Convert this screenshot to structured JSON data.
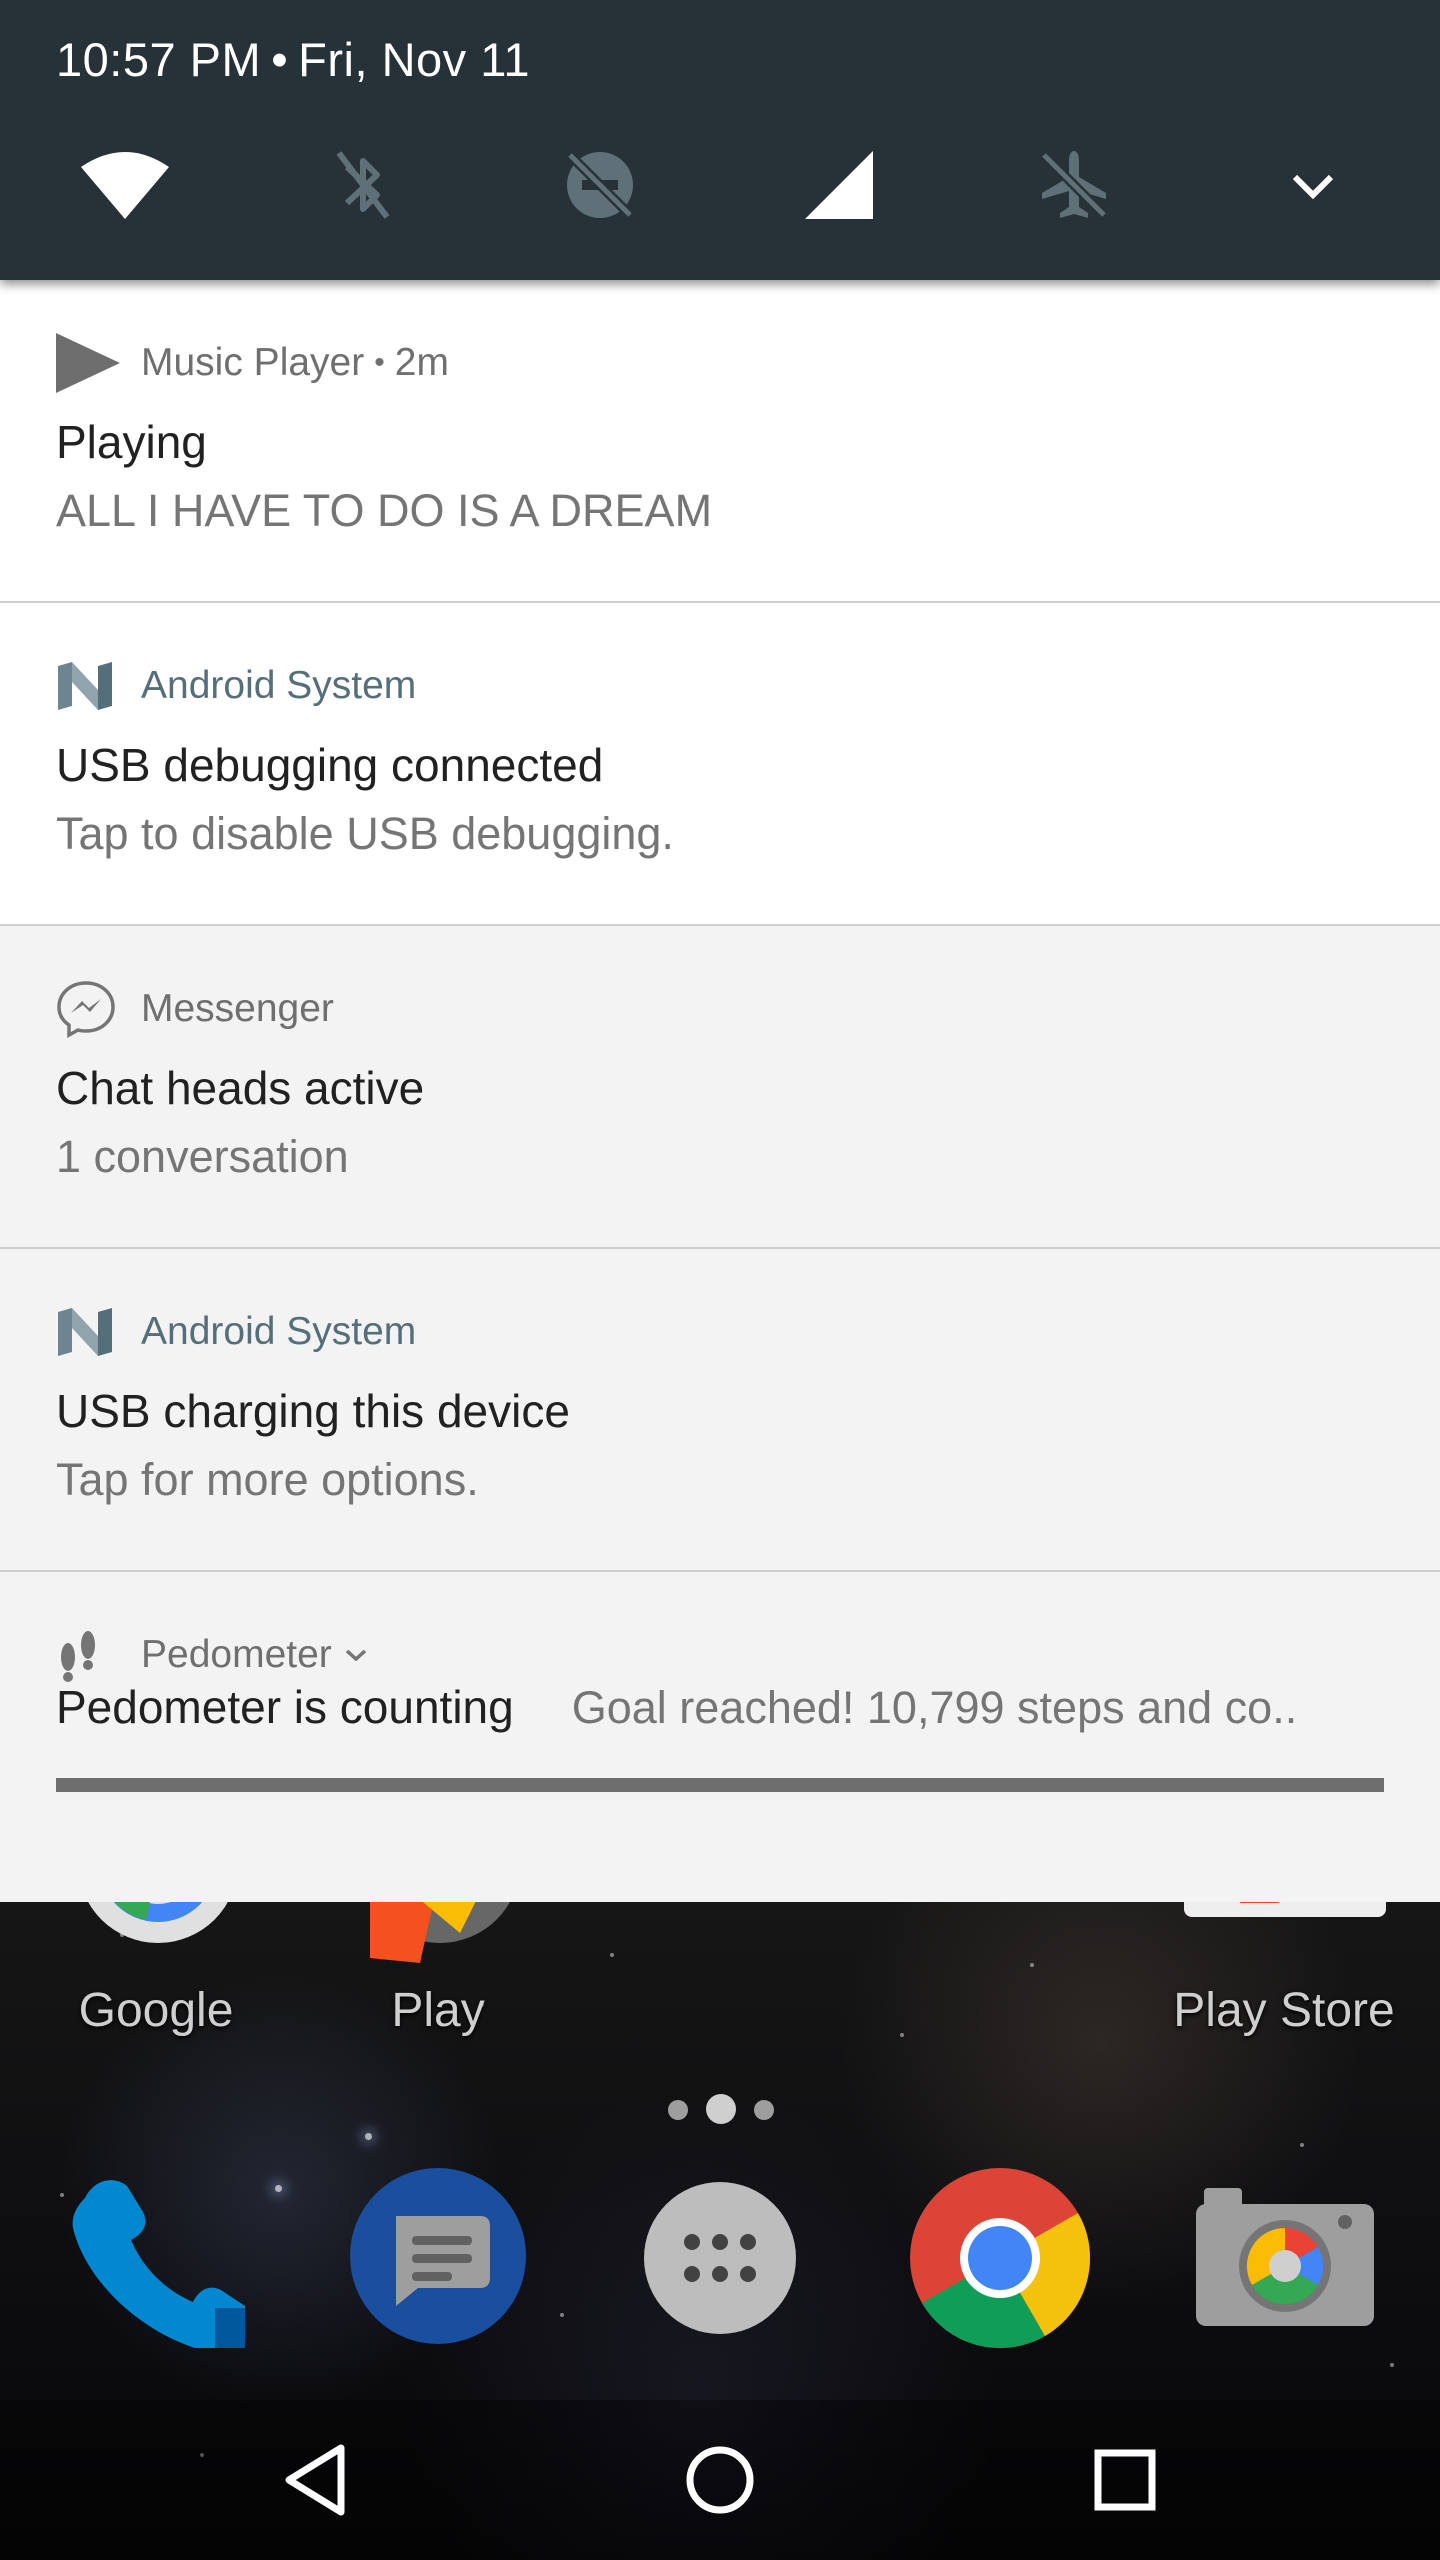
{
  "status": {
    "time": "10:57 PM",
    "separator": "•",
    "date": "Fri, Nov 11"
  },
  "quick_settings": [
    {
      "name": "wifi-icon",
      "state": "on"
    },
    {
      "name": "bluetooth-icon",
      "state": "off"
    },
    {
      "name": "do-not-disturb-icon",
      "state": "off"
    },
    {
      "name": "cellular-signal-icon",
      "state": "on"
    },
    {
      "name": "airplane-mode-icon",
      "state": "off"
    },
    {
      "name": "expand-chevron-icon",
      "state": "collapsed"
    }
  ],
  "notifications": [
    {
      "app": "Music Player",
      "separator": "•",
      "time": "2m",
      "icon": "play-icon",
      "title": "Playing",
      "text": "ALL I HAVE TO DO IS A DREAM"
    },
    {
      "app": "Android System",
      "icon": "android-n-icon",
      "title": "USB debugging connected",
      "text": "Tap to disable USB debugging."
    },
    {
      "app": "Messenger",
      "icon": "messenger-icon",
      "title": "Chat heads active",
      "text": "1 conversation"
    },
    {
      "app": "Android System",
      "icon": "android-n-icon",
      "title": "USB charging this device",
      "text": "Tap for more options."
    },
    {
      "app": "Pedometer",
      "icon": "footprints-icon",
      "title": "Pedometer is counting",
      "text": "Goal reached! 10,799 steps and co..",
      "progress": 1.0
    }
  ],
  "home": {
    "apps": [
      {
        "label": "Google",
        "icon": "google-icon"
      },
      {
        "label": "Play",
        "icon": "play-folder-icon"
      },
      {
        "label": "Play Store",
        "icon": "play-store-icon"
      }
    ],
    "dock": [
      {
        "name": "phone-icon"
      },
      {
        "name": "messages-icon"
      },
      {
        "name": "app-drawer-icon"
      },
      {
        "name": "chrome-icon"
      },
      {
        "name": "camera-icon"
      }
    ]
  },
  "navbar": [
    {
      "name": "back-icon"
    },
    {
      "name": "home-icon"
    },
    {
      "name": "recents-icon"
    }
  ],
  "colors": {
    "header_bg": "#263238",
    "accent_system": "#546e7a",
    "notification_white": "#ffffff",
    "notification_grey": "#f3f3f3"
  }
}
